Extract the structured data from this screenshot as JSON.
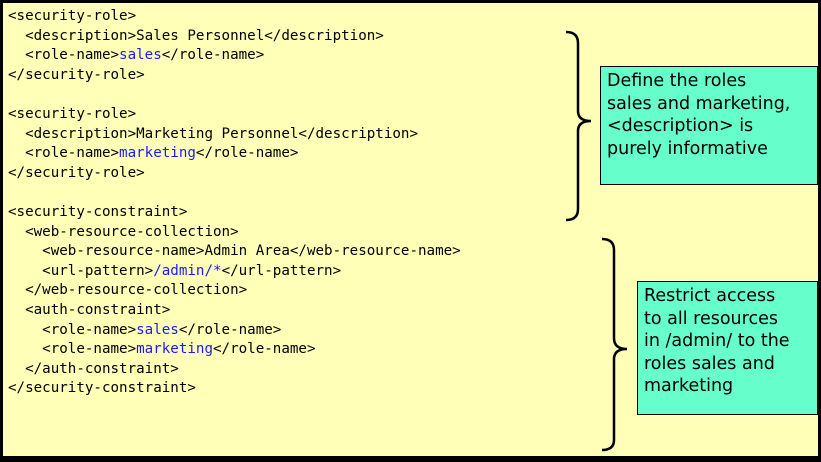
{
  "code_lines": [
    [
      {
        "t": "<security-role>"
      }
    ],
    [
      {
        "t": "  <description>Sales Personnel</description>"
      }
    ],
    [
      {
        "t": "  <role-name>"
      },
      {
        "t": "sales",
        "hl": true
      },
      {
        "t": "</role-name>"
      }
    ],
    [
      {
        "t": "</security-role>"
      }
    ],
    [],
    [
      {
        "t": "<security-role>"
      }
    ],
    [
      {
        "t": "  <description>Marketing Personnel</description>"
      }
    ],
    [
      {
        "t": "  <role-name>"
      },
      {
        "t": "marketing",
        "hl": true
      },
      {
        "t": "</role-name>"
      }
    ],
    [
      {
        "t": "</security-role>"
      }
    ],
    [],
    [
      {
        "t": "<security-constraint>"
      }
    ],
    [
      {
        "t": "  <web-resource-collection>"
      }
    ],
    [
      {
        "t": "    <web-resource-name>Admin Area</web-resource-name>"
      }
    ],
    [
      {
        "t": "    <url-pattern>"
      },
      {
        "t": "/admin/*",
        "hl": true
      },
      {
        "t": "</url-pattern>"
      }
    ],
    [
      {
        "t": "  </web-resource-collection>"
      }
    ],
    [
      {
        "t": "  <auth-constraint>"
      }
    ],
    [
      {
        "t": "    <role-name>"
      },
      {
        "t": "sales",
        "hl": true
      },
      {
        "t": "</role-name>"
      }
    ],
    [
      {
        "t": "    <role-name>"
      },
      {
        "t": "marketing",
        "hl": true
      },
      {
        "t": "</role-name>"
      }
    ],
    [
      {
        "t": "  </auth-constraint>"
      }
    ],
    [
      {
        "t": "</security-constraint>"
      }
    ]
  ],
  "notes": {
    "roles": {
      "lines": [
        "Define the roles",
        "sales and marketing,",
        "<description> is",
        "purely informative"
      ]
    },
    "constraint": {
      "lines": [
        "Restrict access",
        "to all resources",
        "in /admin/ to the",
        "roles sales and",
        "marketing"
      ]
    }
  },
  "colors": {
    "background": "#ffffb8",
    "note_background": "#66ffcc",
    "highlight_text": "#1a1aff"
  }
}
